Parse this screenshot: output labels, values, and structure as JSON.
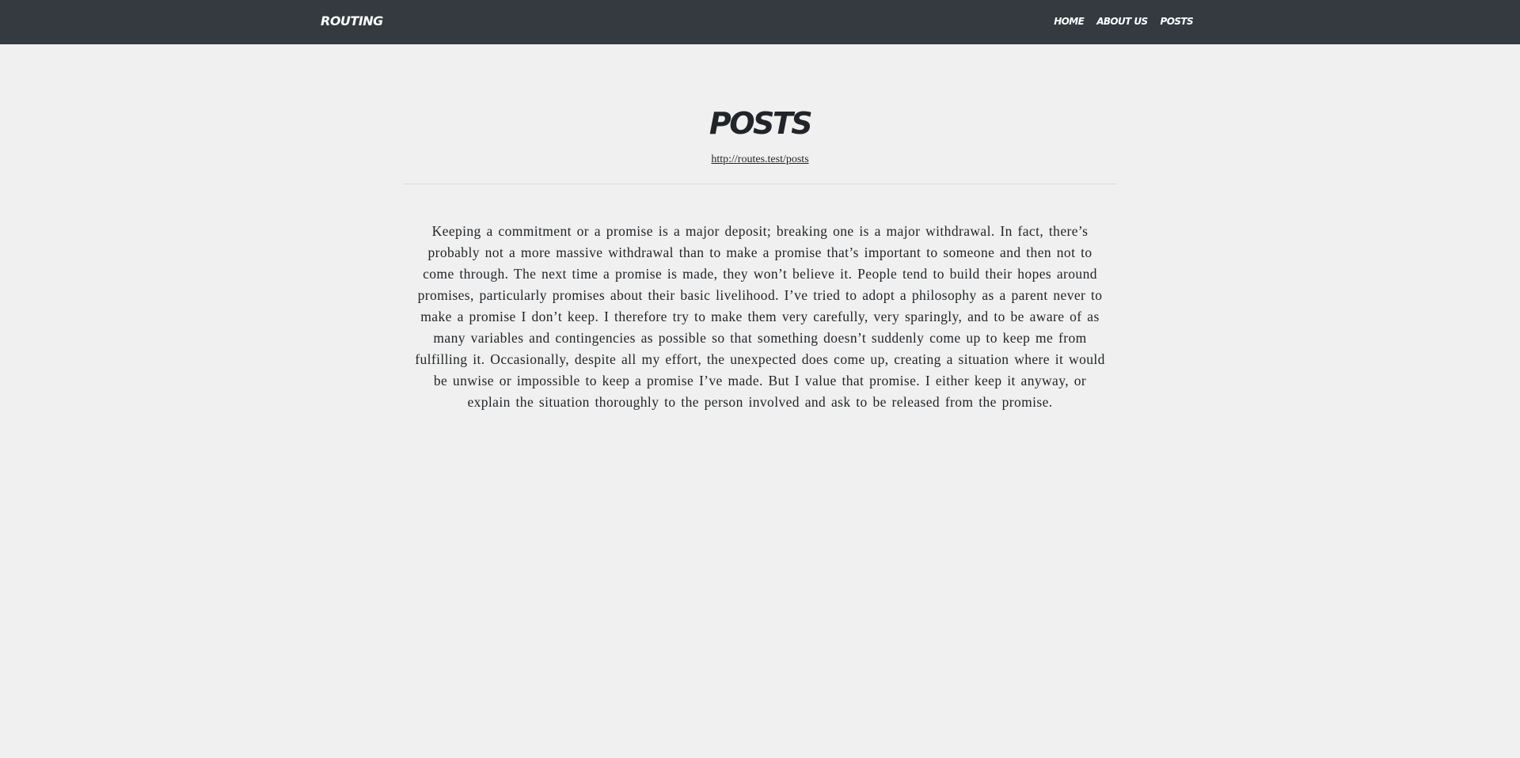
{
  "navbar": {
    "brand": "ROUTING",
    "links": [
      {
        "label": "HOME"
      },
      {
        "label": "ABOUT US"
      },
      {
        "label": "POSTS"
      }
    ],
    "background": "#343a40"
  },
  "header": {
    "title": "POSTS",
    "url": "http://routes.test/posts"
  },
  "content": {
    "paragraph": "Keeping a commitment or a promise is a major deposit; breaking one is a major withdrawal. In fact, there’s probably not a more massive withdrawal than to make a promise that’s important to someone and then not to come through. The next time a promise is made, they won’t believe it. People tend to build their hopes around promises, particularly promises about their basic livelihood. I’ve tried to adopt a philosophy as a parent never to make a promise I don’t keep. I therefore try to make them very carefully, very sparingly, and to be aware of as many variables and contingencies as possible so that something doesn’t suddenly come up to keep me from fulfilling it. Occasionally, despite all my effort, the unexpected does come up, creating a situation where it would be unwise or impossible to keep a promise I’ve made. But I value that promise. I either keep it anyway, or explain the situation thoroughly to the person involved and ask to be released from the promise."
  },
  "colors": {
    "page_background": "#f0f0f0",
    "text": "#212529",
    "divider": "#d9d9d9"
  }
}
